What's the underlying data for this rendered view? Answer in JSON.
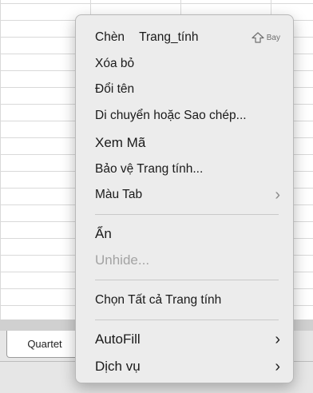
{
  "sheet_tabs": [
    {
      "label": "Quartet"
    }
  ],
  "context_menu": {
    "items": [
      {
        "label_a": "Chèn",
        "label_b": "Trang_tính",
        "shortcut_icon": "shift-icon",
        "shortcut_text": "Bay"
      },
      {
        "label": "Xóa bỏ"
      },
      {
        "label": "Đổi tên"
      },
      {
        "label": "Di chuyển hoặc Sao chép..."
      },
      {
        "label": "Xem Mã"
      },
      {
        "label": "Bảo vệ Trang tính..."
      },
      {
        "label": "Màu Tab",
        "submenu": true
      },
      {
        "label": "Ẩn"
      },
      {
        "label": "Unhide...",
        "disabled": true
      },
      {
        "label": "Chọn Tất cả Trang tính"
      },
      {
        "label": "AutoFill",
        "submenu": true
      },
      {
        "label": "Dịch vụ",
        "submenu": true
      }
    ]
  },
  "colors": {
    "menu_bg": "#ececec",
    "disabled_text": "#a3a3a3",
    "grid_line": "#d9d9d9"
  }
}
